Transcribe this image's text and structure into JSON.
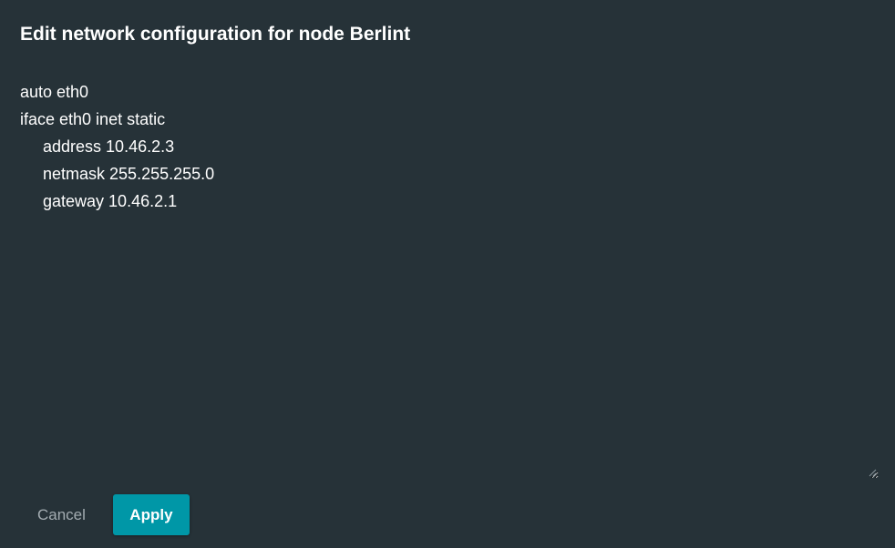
{
  "dialog": {
    "title": "Edit network configuration for node Berlint"
  },
  "editor": {
    "value": "auto eth0\niface eth0 inet static\n     address 10.46.2.3\n     netmask 255.255.255.0\n     gateway 10.46.2.1"
  },
  "actions": {
    "cancel_label": "Cancel",
    "apply_label": "Apply"
  },
  "colors": {
    "background": "#263238",
    "accent": "#0097a7",
    "text": "#ffffff",
    "muted_text": "#a3acb1"
  },
  "icons": {
    "resize_handle": "resize-grip-icon"
  }
}
